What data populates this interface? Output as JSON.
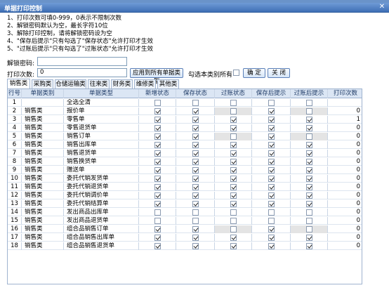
{
  "window": {
    "title": "单据打印控制",
    "close_glyph": "✕"
  },
  "notes": [
    "1、打印次数可填0-999，0表示不限制次数",
    "2、解锁密码默认为空，最长字符10位",
    "3、解除打印控制，请将解锁密码设为空",
    "4、\"保存后提示\"只有勾选了\"保存状态\"允许打印才生效",
    "5、\"过账后提示\"只有勾选了\"过账状态\"允许打印才生效"
  ],
  "form": {
    "password_label": "解锁密码:",
    "password_value": "",
    "print_count_label": "打印次数:",
    "print_count_value": "0",
    "apply_all_button": "应用到所有单据类型",
    "check_all_label": "勾选本类别所有",
    "confirm_button": "确 定",
    "close_button": "关 闭"
  },
  "tabs": [
    "销售类",
    "采购类",
    "仓储运输类",
    "往来类",
    "财务类",
    "维修类",
    "其他类"
  ],
  "grid": {
    "headers": [
      "行号",
      "单据类别",
      "单据类型",
      "新增状态",
      "保存状态",
      "过账状态",
      "保存后提示",
      "过账后提示",
      "打印次数"
    ],
    "rows": [
      {
        "no": "1",
        "cat": "",
        "type": "全选全清",
        "c": [
          false,
          false,
          false,
          false,
          false
        ],
        "dis": [
          false,
          false,
          false,
          false,
          false
        ],
        "count": ""
      },
      {
        "no": "2",
        "cat": "销售类",
        "type": "报价单",
        "c": [
          true,
          true,
          false,
          true,
          false
        ],
        "dis": [
          false,
          false,
          true,
          false,
          true
        ],
        "count": "0"
      },
      {
        "no": "3",
        "cat": "销售类",
        "type": "零售单",
        "c": [
          true,
          true,
          true,
          true,
          true
        ],
        "dis": [
          false,
          false,
          false,
          false,
          false
        ],
        "count": "1"
      },
      {
        "no": "4",
        "cat": "销售类",
        "type": "零售退货单",
        "c": [
          true,
          true,
          true,
          true,
          true
        ],
        "dis": [
          false,
          false,
          false,
          false,
          false
        ],
        "count": "0"
      },
      {
        "no": "5",
        "cat": "销售类",
        "type": "销售订单",
        "c": [
          true,
          true,
          false,
          true,
          false
        ],
        "dis": [
          false,
          false,
          true,
          false,
          true
        ],
        "count": "0"
      },
      {
        "no": "6",
        "cat": "销售类",
        "type": "销售出库单",
        "c": [
          true,
          true,
          true,
          true,
          true
        ],
        "dis": [
          false,
          false,
          false,
          false,
          false
        ],
        "count": "0"
      },
      {
        "no": "7",
        "cat": "销售类",
        "type": "销售退货单",
        "c": [
          true,
          true,
          true,
          true,
          true
        ],
        "dis": [
          false,
          false,
          false,
          false,
          false
        ],
        "count": "0"
      },
      {
        "no": "8",
        "cat": "销售类",
        "type": "销售换货单",
        "c": [
          true,
          true,
          true,
          true,
          true
        ],
        "dis": [
          false,
          false,
          false,
          false,
          false
        ],
        "count": "0"
      },
      {
        "no": "9",
        "cat": "销售类",
        "type": "赠送单",
        "c": [
          true,
          true,
          true,
          true,
          true
        ],
        "dis": [
          false,
          false,
          false,
          false,
          false
        ],
        "count": "0"
      },
      {
        "no": "10",
        "cat": "销售类",
        "type": "委托代销发货单",
        "c": [
          true,
          true,
          true,
          true,
          true
        ],
        "dis": [
          false,
          false,
          false,
          false,
          false
        ],
        "count": "0"
      },
      {
        "no": "11",
        "cat": "销售类",
        "type": "委托代销退货单",
        "c": [
          true,
          true,
          true,
          true,
          true
        ],
        "dis": [
          false,
          false,
          false,
          false,
          false
        ],
        "count": "0"
      },
      {
        "no": "12",
        "cat": "销售类",
        "type": "委托代销调价单",
        "c": [
          true,
          true,
          true,
          true,
          true
        ],
        "dis": [
          false,
          false,
          false,
          false,
          false
        ],
        "count": "0"
      },
      {
        "no": "13",
        "cat": "销售类",
        "type": "委托代销结算单",
        "c": [
          true,
          true,
          true,
          true,
          true
        ],
        "dis": [
          false,
          false,
          false,
          false,
          false
        ],
        "count": "0"
      },
      {
        "no": "14",
        "cat": "销售类",
        "type": "发出商品出库单",
        "c": [
          false,
          false,
          false,
          false,
          false
        ],
        "dis": [
          false,
          false,
          false,
          false,
          false
        ],
        "count": "0"
      },
      {
        "no": "15",
        "cat": "销售类",
        "type": "发出商品退货单",
        "c": [
          false,
          false,
          false,
          false,
          false
        ],
        "dis": [
          false,
          false,
          false,
          false,
          false
        ],
        "count": "0"
      },
      {
        "no": "16",
        "cat": "销售类",
        "type": "组合品销售订单",
        "c": [
          true,
          true,
          false,
          true,
          false
        ],
        "dis": [
          false,
          false,
          true,
          false,
          true
        ],
        "count": "0"
      },
      {
        "no": "17",
        "cat": "销售类",
        "type": "组合品销售出库单",
        "c": [
          true,
          true,
          true,
          true,
          true
        ],
        "dis": [
          false,
          false,
          false,
          false,
          false
        ],
        "count": "0"
      },
      {
        "no": "18",
        "cat": "销售类",
        "type": "组合品销售退货单",
        "c": [
          true,
          true,
          true,
          true,
          true
        ],
        "dis": [
          false,
          false,
          false,
          false,
          false
        ],
        "count": "0"
      }
    ]
  }
}
